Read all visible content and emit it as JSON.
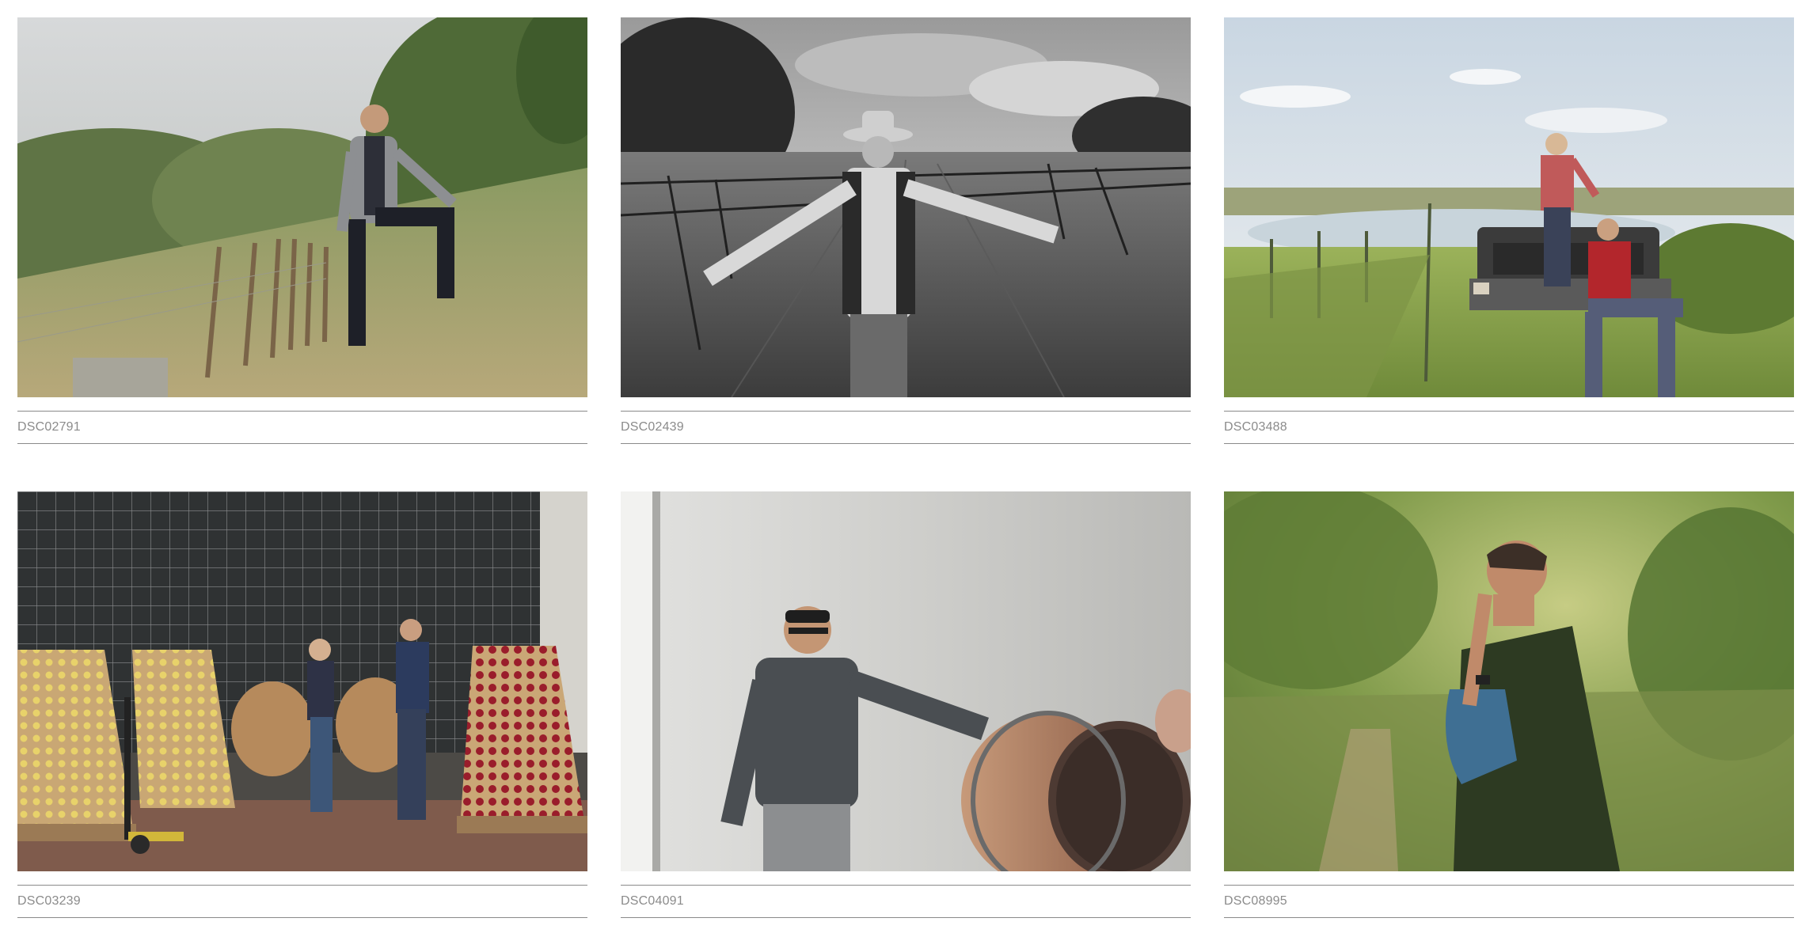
{
  "gallery": {
    "items": [
      {
        "caption": "DSC02791"
      },
      {
        "caption": "DSC02439"
      },
      {
        "caption": "DSC03488"
      },
      {
        "caption": "DSC03239"
      },
      {
        "caption": "DSC04091"
      },
      {
        "caption": "DSC08995"
      }
    ]
  }
}
